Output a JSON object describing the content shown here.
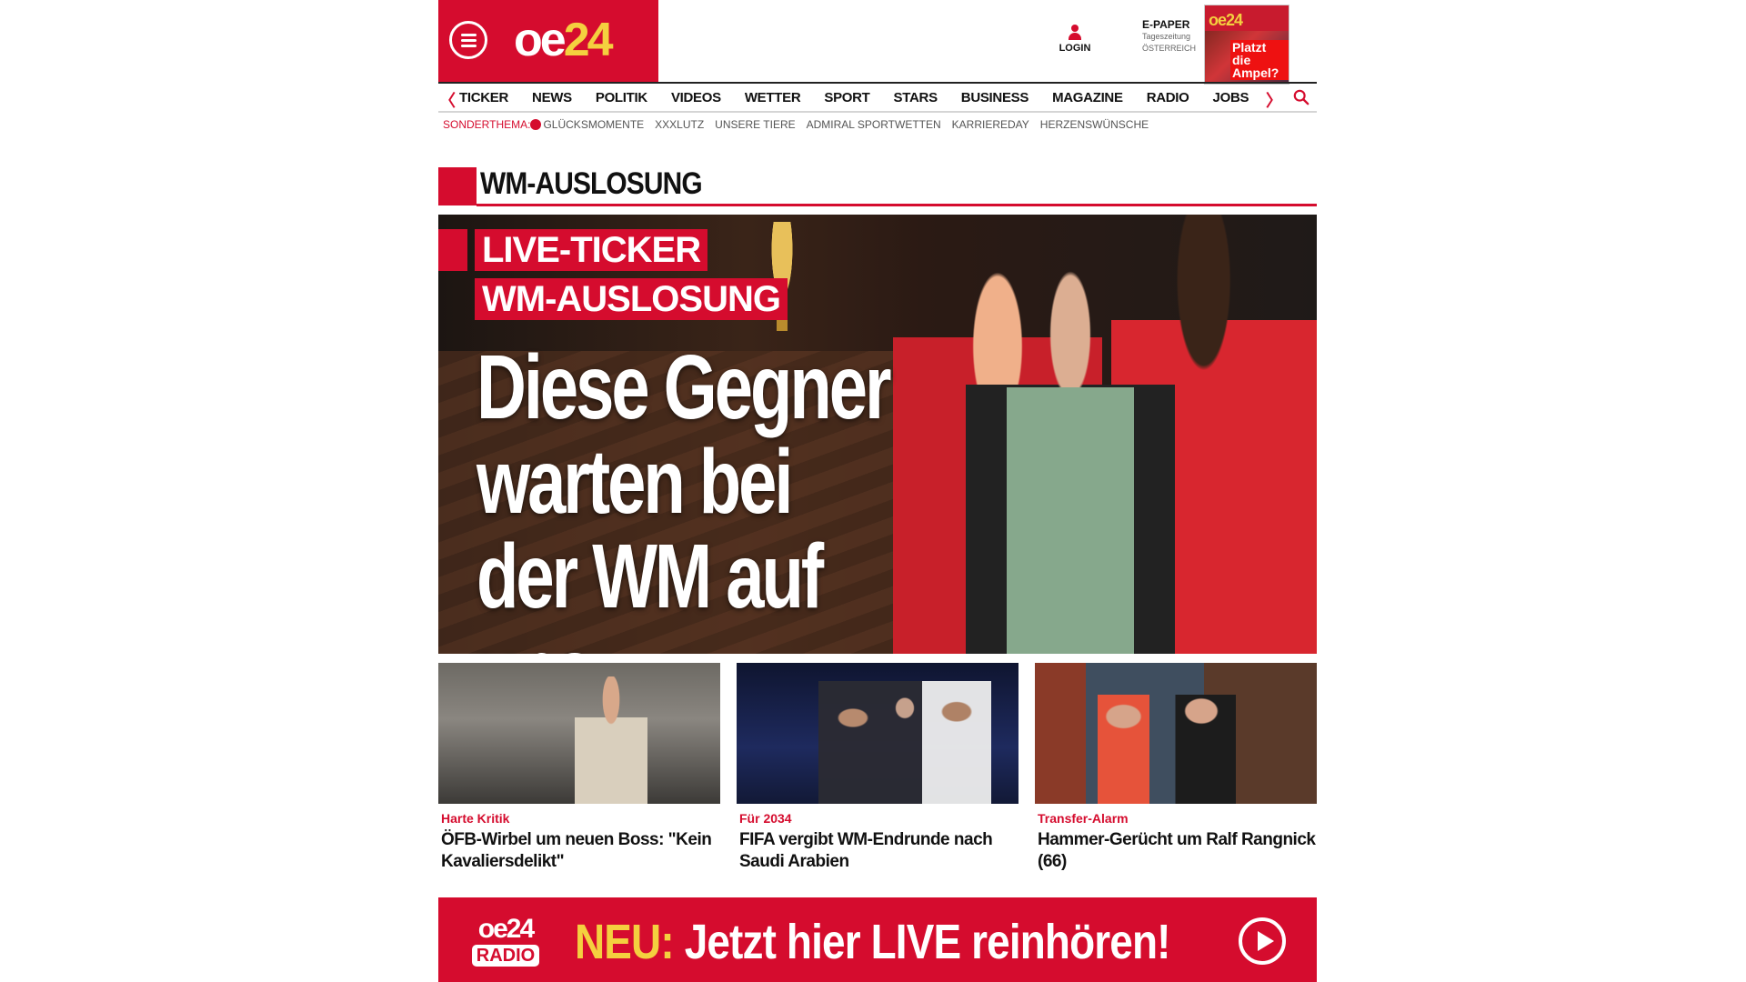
{
  "brand": {
    "logo_oe": "oe",
    "logo_24": "24"
  },
  "header": {
    "login_label": "LOGIN",
    "epaper": {
      "title": "E-PAPER",
      "sub1": "Tageszeitung",
      "sub2": "ÖSTERREICH",
      "thumb_logo": "oe24",
      "thumb_headline": "Platzt die Ampel?"
    }
  },
  "nav": {
    "items": [
      "TICKER",
      "NEWS",
      "POLITIK",
      "VIDEOS",
      "WETTER",
      "SPORT",
      "STARS",
      "BUSINESS",
      "MAGAZINE",
      "RADIO",
      "JOBS"
    ],
    "left_chevron": "〈",
    "right_chevron": "〉"
  },
  "subnav": {
    "label": "SONDERTHEMA:",
    "items": [
      "GLÜCKSMOMENTE",
      "XXXLUTZ",
      "UNSERE TIERE",
      "ADMIRAL SPORTWETTEN",
      "KARRIEREDAY",
      "HERZENSWÜNSCHE"
    ]
  },
  "section": {
    "title": "WM-AUSLOSUNG"
  },
  "hero": {
    "tag1": "LIVE-TICKER",
    "tag2": "WM-AUSLOSUNG",
    "headline_lines": [
      "Diese Gegner",
      "warten bei",
      "der WM auf uns"
    ]
  },
  "cards": [
    {
      "kicker": "Harte Kritik",
      "title": "ÖFB-Wirbel um neuen Boss: \"Kein Kavaliersdelikt\""
    },
    {
      "kicker": "Für 2034",
      "title": "FIFA vergibt WM-Endrunde nach Saudi Arabien"
    },
    {
      "kicker": "Transfer-Alarm",
      "title": "Hammer-Gerücht um Ralf Rangnick (66)"
    }
  ],
  "radio": {
    "logo_top": "oe24",
    "logo_bottom": "RADIO",
    "neu": "NEU:",
    "text": " Jetzt hier LIVE reinhören!"
  },
  "colors": {
    "brand_red": "#d50c2e",
    "brand_yellow": "#f4d03f"
  },
  "icons": [
    "menu-icon",
    "user-icon",
    "search-icon",
    "play-icon"
  ]
}
